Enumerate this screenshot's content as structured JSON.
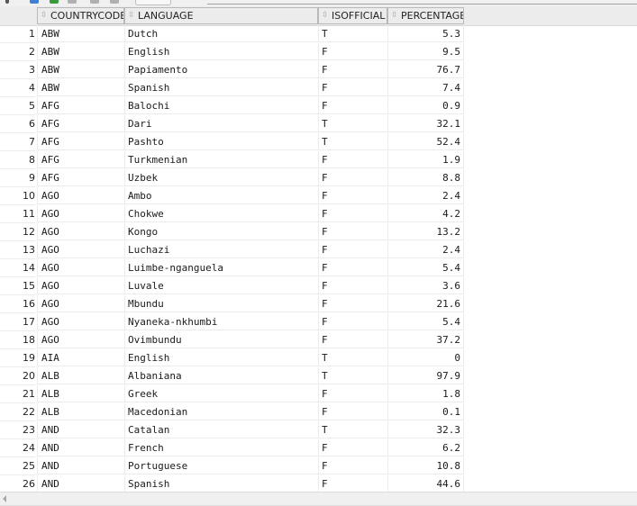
{
  "toolbar": {
    "icons": [
      "pin-icon",
      "save-icon",
      "export-icon",
      "refresh-icon",
      "filter-icon",
      "sql-icon"
    ]
  },
  "table": {
    "columns": [
      {
        "key": "countrycode",
        "label": "COUNTRYCODE"
      },
      {
        "key": "language",
        "label": "LANGUAGE"
      },
      {
        "key": "isofficial",
        "label": "ISOFFICIAL"
      },
      {
        "key": "percentage",
        "label": "PERCENTAGE"
      }
    ],
    "sort_icon": "sort-arrows-icon",
    "rows": [
      {
        "n": "1",
        "countrycode": "ABW",
        "language": "Dutch",
        "isofficial": "T",
        "percentage": "5.3"
      },
      {
        "n": "2",
        "countrycode": "ABW",
        "language": "English",
        "isofficial": "F",
        "percentage": "9.5"
      },
      {
        "n": "3",
        "countrycode": "ABW",
        "language": "Papiamento",
        "isofficial": "F",
        "percentage": "76.7"
      },
      {
        "n": "4",
        "countrycode": "ABW",
        "language": "Spanish",
        "isofficial": "F",
        "percentage": "7.4"
      },
      {
        "n": "5",
        "countrycode": "AFG",
        "language": "Balochi",
        "isofficial": "F",
        "percentage": "0.9"
      },
      {
        "n": "6",
        "countrycode": "AFG",
        "language": "Dari",
        "isofficial": "T",
        "percentage": "32.1"
      },
      {
        "n": "7",
        "countrycode": "AFG",
        "language": "Pashto",
        "isofficial": "T",
        "percentage": "52.4"
      },
      {
        "n": "8",
        "countrycode": "AFG",
        "language": "Turkmenian",
        "isofficial": "F",
        "percentage": "1.9"
      },
      {
        "n": "9",
        "countrycode": "AFG",
        "language": "Uzbek",
        "isofficial": "F",
        "percentage": "8.8"
      },
      {
        "n": "10",
        "countrycode": "AGO",
        "language": "Ambo",
        "isofficial": "F",
        "percentage": "2.4"
      },
      {
        "n": "11",
        "countrycode": "AGO",
        "language": "Chokwe",
        "isofficial": "F",
        "percentage": "4.2"
      },
      {
        "n": "12",
        "countrycode": "AGO",
        "language": "Kongo",
        "isofficial": "F",
        "percentage": "13.2"
      },
      {
        "n": "13",
        "countrycode": "AGO",
        "language": "Luchazi",
        "isofficial": "F",
        "percentage": "2.4"
      },
      {
        "n": "14",
        "countrycode": "AGO",
        "language": "Luimbe-nganguela",
        "isofficial": "F",
        "percentage": "5.4"
      },
      {
        "n": "15",
        "countrycode": "AGO",
        "language": "Luvale",
        "isofficial": "F",
        "percentage": "3.6"
      },
      {
        "n": "16",
        "countrycode": "AGO",
        "language": "Mbundu",
        "isofficial": "F",
        "percentage": "21.6"
      },
      {
        "n": "17",
        "countrycode": "AGO",
        "language": "Nyaneka-nkhumbi",
        "isofficial": "F",
        "percentage": "5.4"
      },
      {
        "n": "18",
        "countrycode": "AGO",
        "language": "Ovimbundu",
        "isofficial": "F",
        "percentage": "37.2"
      },
      {
        "n": "19",
        "countrycode": "AIA",
        "language": "English",
        "isofficial": "T",
        "percentage": "0"
      },
      {
        "n": "20",
        "countrycode": "ALB",
        "language": "Albaniana",
        "isofficial": "T",
        "percentage": "97.9"
      },
      {
        "n": "21",
        "countrycode": "ALB",
        "language": "Greek",
        "isofficial": "F",
        "percentage": "1.8"
      },
      {
        "n": "22",
        "countrycode": "ALB",
        "language": "Macedonian",
        "isofficial": "F",
        "percentage": "0.1"
      },
      {
        "n": "23",
        "countrycode": "AND",
        "language": "Catalan",
        "isofficial": "T",
        "percentage": "32.3"
      },
      {
        "n": "24",
        "countrycode": "AND",
        "language": "French",
        "isofficial": "F",
        "percentage": "6.2"
      },
      {
        "n": "25",
        "countrycode": "AND",
        "language": "Portuguese",
        "isofficial": "F",
        "percentage": "10.8"
      },
      {
        "n": "26",
        "countrycode": "AND",
        "language": "Spanish",
        "isofficial": "F",
        "percentage": "44.6"
      }
    ]
  },
  "colors": {
    "header_bg": "#ececec",
    "grid_line": "#ececec",
    "text": "#1a1a1a"
  }
}
